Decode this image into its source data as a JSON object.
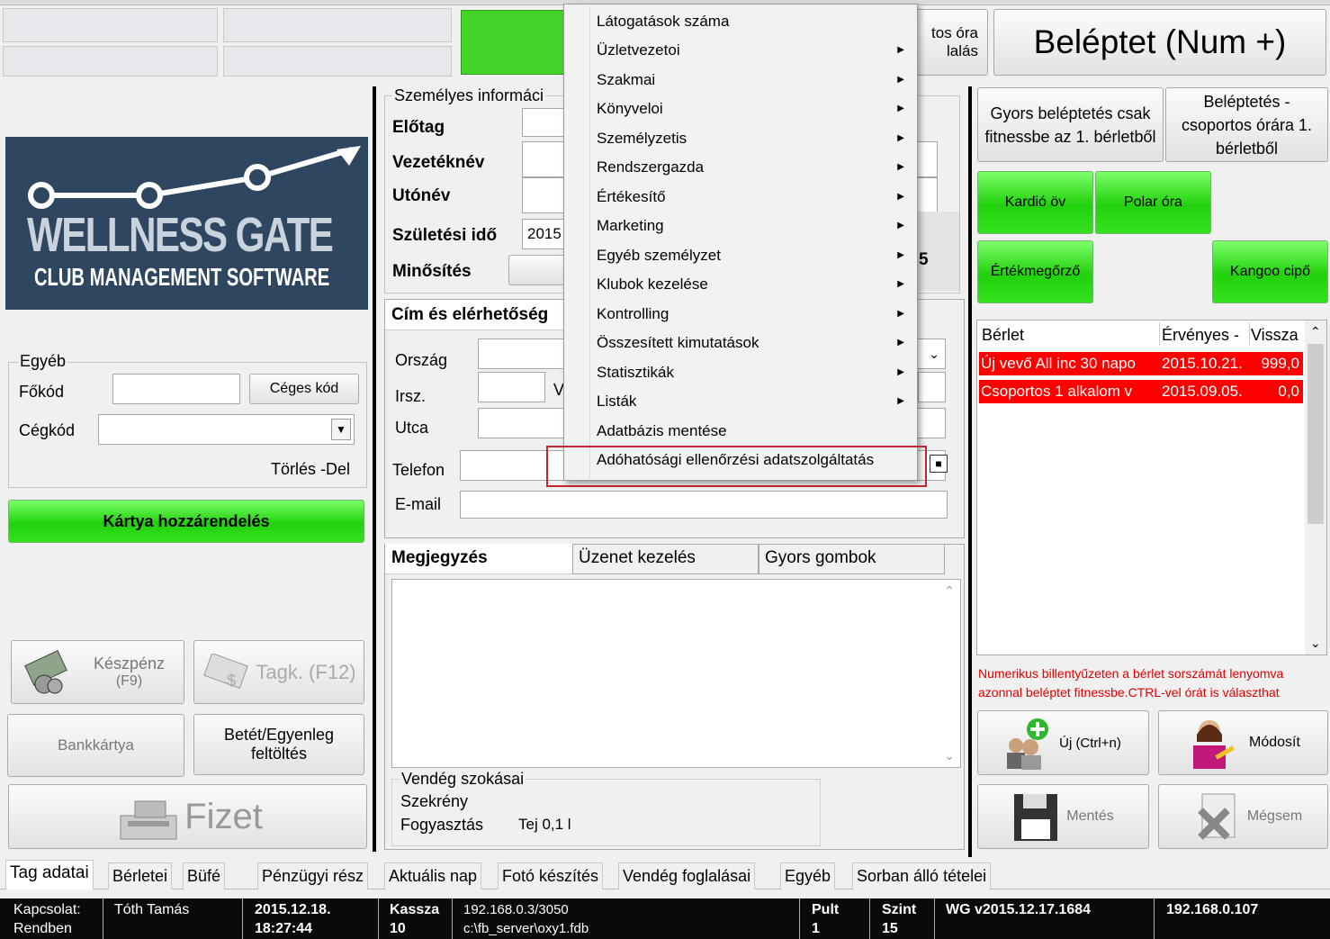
{
  "top": {
    "partial_btn_line1": "tos óra",
    "partial_btn_line2": "lalás",
    "beleptet": "Beléptet (Num +)"
  },
  "menu": {
    "items": [
      {
        "label": "Látogatások száma",
        "sub": false
      },
      {
        "label": "Üzletvezetoi",
        "sub": true
      },
      {
        "label": "Szakmai",
        "sub": true
      },
      {
        "label": "Könyveloi",
        "sub": true
      },
      {
        "label": "Személyzetis",
        "sub": true
      },
      {
        "label": "Rendszergazda",
        "sub": true
      },
      {
        "label": "Értékesítő",
        "sub": true
      },
      {
        "label": "Marketing",
        "sub": true
      },
      {
        "label": "Egyéb személyzet",
        "sub": true
      },
      {
        "label": "Klubok kezelése",
        "sub": true
      },
      {
        "label": "Kontrolling",
        "sub": true
      },
      {
        "label": "Összesített kimutatások",
        "sub": true
      },
      {
        "label": "Statisztikák",
        "sub": true
      },
      {
        "label": "Listák",
        "sub": true
      },
      {
        "label": "Adatbázis mentése",
        "sub": false
      },
      {
        "label": "Adóhatósági ellenőrzési adatszolgáltatás",
        "sub": false
      }
    ],
    "arrow_glyph": "▶"
  },
  "logo": {
    "line1": "WELLNESS GATE",
    "line2": "CLUB MANAGEMENT SOFTWARE"
  },
  "left": {
    "egyeb_legend": "Egyéb",
    "fokod": "Főkód",
    "ceges_kod_btn": "Céges kód",
    "cegkod": "Cégkód",
    "torles": "Törlés -Del",
    "kartya": "Kártya hozzárendelés",
    "keszpenz1": "Készpénz",
    "keszpenz2": "(F9)",
    "tagk": "Tagk. (F12)",
    "bankkartya": "Bankkártya",
    "betet1": "Betét/Egyenleg",
    "betet2": "feltöltés",
    "fizet": "Fizet"
  },
  "personal": {
    "legend": "Személyes informáci",
    "elotag": "Előtag",
    "vezeteknev": "Vezetéknév",
    "utonev": "Utónév",
    "szuletesi": "Születési idő",
    "szuletesi_val": "2015",
    "minosites": "Minősítés",
    "partial5": "5"
  },
  "contact": {
    "tab": "Cím és elérhetőség",
    "orszag": "Ország",
    "irsz": "Irsz.",
    "v": "V",
    "utca": "Utca",
    "telefon": "Telefon",
    "email": "E-mail"
  },
  "notes": {
    "tab1": "Megjegyzés",
    "tab2": "Üzenet kezelés",
    "tab3": "Gyors gombok",
    "habits_legend": "Vendég szokásai",
    "szekreny": "Szekrény",
    "fogyasztas": "Fogyasztás",
    "fogyasztas_val": "Tej 0,1 l"
  },
  "right": {
    "gyors1": "Gyors beléptetés csak fitnessbe az 1. bérletből",
    "gyors2": "Beléptetés - csoportos órára 1. bérletből",
    "kardio": "Kardió öv",
    "polar": "Polar óra",
    "ertek": "Értékmegőrző",
    "kangoo": "Kangoo cipő",
    "col1": "Bérlet",
    "col2": "Érvényes -",
    "col3": "Vissza",
    "rows": [
      {
        "berlet": "Új vevő All inc 30 napo",
        "ervenyes": "2015.10.21.",
        "vissza": "999,0"
      },
      {
        "berlet": "Csoportos 1 alkalom v",
        "ervenyes": "2015.09.05.",
        "vissza": "0,0"
      }
    ],
    "hint": "Numerikus billentyűzeten a bérlet sorszámát lenyomva azonnal beléptet fitnessbe.CTRL-vel órát is választhat",
    "uj": "Új (Ctrl+n)",
    "modosit": "Módosít",
    "mentes": "Mentés",
    "megsem": "Mégsem"
  },
  "tabs": [
    "Tag adatai",
    "Bérletei",
    "Büfé",
    "Pénzügyi rész",
    "Aktuális nap",
    "Fotó készítés",
    "Vendég foglalásai",
    "Egyéb",
    "Sorban álló tételei"
  ],
  "status": {
    "kapcsolat1": "Kapcsolat:",
    "kapcsolat2": "Rendben",
    "user": "Tóth Tamás",
    "date": "2015.12.18.",
    "time": "18:27:44",
    "kassza1": "Kassza",
    "kassza2": "10",
    "server1": "192.168.0.3/3050",
    "server2": "c:\\fb_server\\oxy1.fdb",
    "pult1": "Pult",
    "pult2": "1",
    "szint1": "Szint",
    "szint2": "15",
    "version": "WG v2015.12.17.1684",
    "ip": "192.168.0.107"
  },
  "colors": {
    "green": "#21d10c",
    "red": "#ff0000",
    "highlight": "#c0262d"
  }
}
